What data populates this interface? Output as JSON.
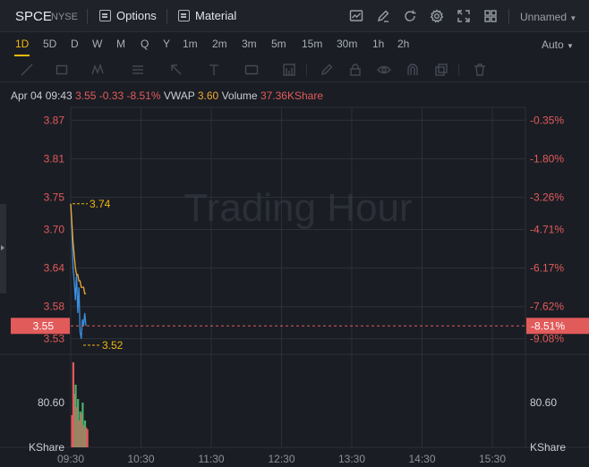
{
  "header": {
    "symbol": "SPCE",
    "exchange": "NYSE",
    "options_label": "Options",
    "material_label": "Material",
    "layout_name": "Unnamed"
  },
  "periods": [
    {
      "label": "1D",
      "active": true
    },
    {
      "label": "5D"
    },
    {
      "label": "D"
    },
    {
      "label": "W"
    },
    {
      "label": "M"
    },
    {
      "label": "Q"
    },
    {
      "label": "Y"
    },
    {
      "label": "1m"
    },
    {
      "label": "2m"
    },
    {
      "label": "3m"
    },
    {
      "label": "5m"
    },
    {
      "label": "15m"
    },
    {
      "label": "30m"
    },
    {
      "label": "1h"
    },
    {
      "label": "2h"
    }
  ],
  "scale_mode": "Auto",
  "info": {
    "datetime": "Apr 04 09:43",
    "price": "3.55",
    "change": "-0.33",
    "change_pct": "-8.51%",
    "vwap_label": "VWAP",
    "vwap": "3.60",
    "volume_label": "Volume",
    "volume": "37.36KShare"
  },
  "watermark": "Trading Hour",
  "colors": {
    "background": "#1a1d24",
    "grid": "#2c3038",
    "price_line": "#3b8fe0",
    "vwap_line": "#f0a830",
    "down": "#e25b5b",
    "up": "#4caf6a",
    "accent": "#f0b90b"
  },
  "chart_data": {
    "type": "line",
    "y_ticks_left": [
      "3.87",
      "3.81",
      "3.75",
      "3.70",
      "3.64",
      "3.58",
      "3.55",
      "3.53"
    ],
    "y_ticks_right": [
      "-0.35%",
      "-1.80%",
      "-3.26%",
      "-4.71%",
      "-6.17%",
      "-7.62%",
      "-8.51%",
      "-9.08%"
    ],
    "x_ticks": [
      "09:30",
      "10:30",
      "11:30",
      "12:30",
      "13:30",
      "14:30",
      "15:30"
    ],
    "ylim": [
      3.51,
      3.89
    ],
    "current_price": 3.55,
    "current_pct": "-8.51%",
    "high_label": "3.74",
    "low_label": "3.52",
    "volume_tick": "80.60",
    "volume_unit": "KShare",
    "series": [
      {
        "type": "price",
        "x": [
          "09:30",
          "09:31",
          "09:32",
          "09:33",
          "09:34",
          "09:35",
          "09:36",
          "09:37",
          "09:38",
          "09:39",
          "09:40",
          "09:41",
          "09:42",
          "09:43"
        ],
        "values": [
          3.74,
          3.7,
          3.64,
          3.62,
          3.59,
          3.63,
          3.57,
          3.61,
          3.54,
          3.53,
          3.56,
          3.55,
          3.57,
          3.55
        ]
      },
      {
        "type": "vwap",
        "x": [
          "09:30",
          "09:31",
          "09:32",
          "09:33",
          "09:34",
          "09:35",
          "09:36",
          "09:37",
          "09:38",
          "09:39",
          "09:40",
          "09:41",
          "09:42",
          "09:43"
        ],
        "values": [
          3.74,
          3.71,
          3.68,
          3.66,
          3.64,
          3.63,
          3.63,
          3.62,
          3.62,
          3.61,
          3.61,
          3.61,
          3.6,
          3.6
        ]
      }
    ],
    "volume": {
      "x": [
        "09:30",
        "09:31",
        "09:32",
        "09:33",
        "09:34",
        "09:35",
        "09:36",
        "09:37",
        "09:38",
        "09:39",
        "09:40",
        "09:41",
        "09:42",
        "09:43"
      ],
      "values": [
        36,
        95,
        60,
        70,
        45,
        54,
        30,
        40,
        38,
        50,
        25,
        30,
        22,
        20
      ],
      "colors": [
        "down",
        "down",
        "down",
        "up",
        "down",
        "up",
        "down",
        "up",
        "down",
        "up",
        "down",
        "up",
        "down",
        "down"
      ]
    }
  }
}
